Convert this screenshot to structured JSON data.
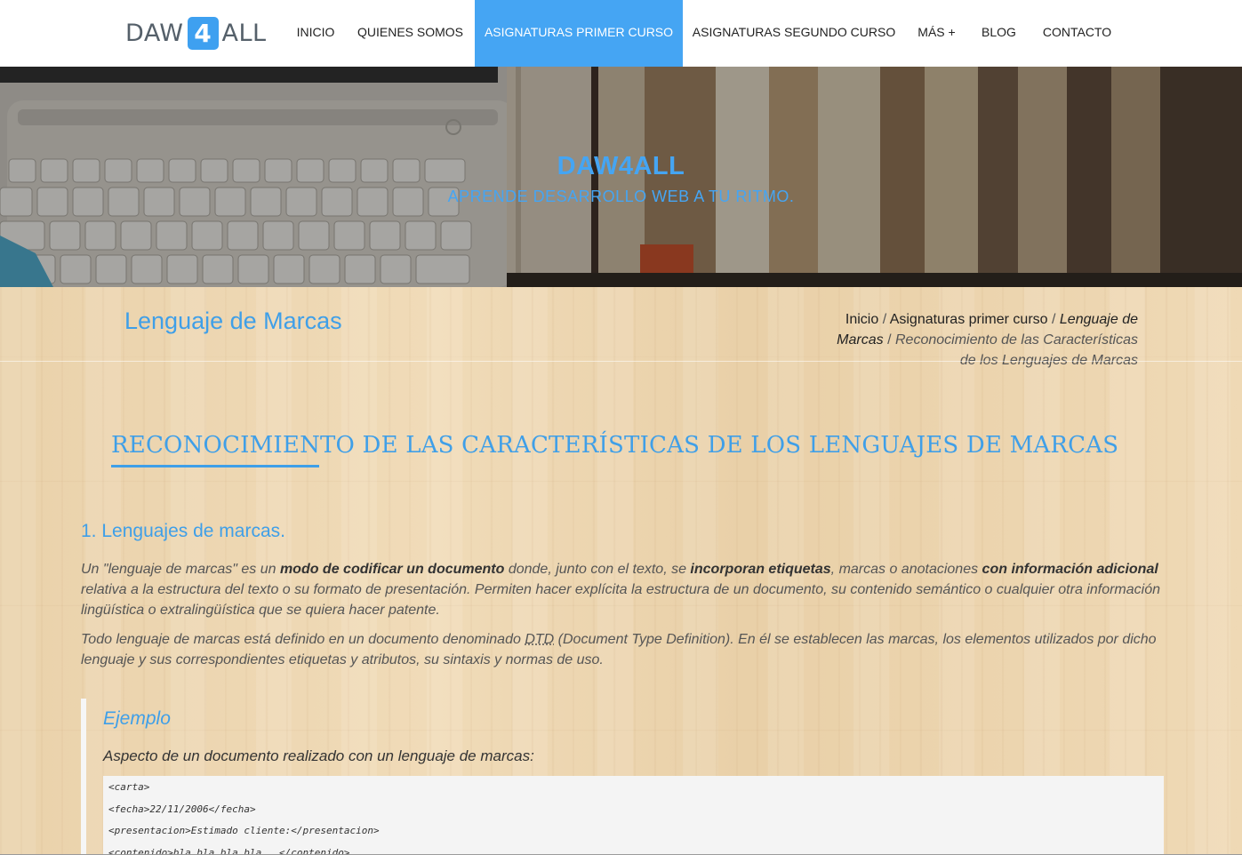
{
  "navbar": {
    "logo": {
      "left": "DAW",
      "number": "4",
      "right": "ALL"
    },
    "items": [
      {
        "label": "INICIO",
        "active": false
      },
      {
        "label": "QUIENES SOMOS",
        "active": false
      },
      {
        "label": "ASIGNATURAS PRIMER CURSO",
        "active": true
      },
      {
        "label": "ASIGNATURAS SEGUNDO CURSO",
        "active": false
      },
      {
        "label": "MÁS +",
        "active": false
      },
      {
        "label": "BLOG",
        "active": false
      },
      {
        "label": "CONTACTO",
        "active": false
      }
    ]
  },
  "hero": {
    "title": "DAW4ALL",
    "subtitle": "APRENDE DESARROLLO WEB A TU RITMO."
  },
  "section": {
    "title": "Lenguaje de Marcas",
    "breadcrumb": {
      "home": "Inicio",
      "category": "Asignaturas primer curso",
      "subject": "Lenguaje de Marcas",
      "current": "Reconocimiento de las Características de los Lenguajes de Marcas",
      "separator": "/"
    }
  },
  "article": {
    "title": "RECONOCIMIENTO DE LAS CARACTERÍSTICAS DE LOS LENGUAJES DE MARCAS",
    "heading": "1. Lenguajes de marcas.",
    "p1": {
      "a": "Un \"lenguaje de marcas\" es un ",
      "b": "modo de codificar un documento",
      "c": " donde, junto con el texto, se ",
      "d": "incorporan etiquetas",
      "e": ", marcas o anotaciones ",
      "f": "con información adicional",
      "g": " relativa a la estructura del texto o su formato de presentación. Permiten hacer explícita la estructura de un documento, su contenido semántico o cualquier otra información lingüística o extralingüística que se quiera hacer patente."
    },
    "p2": {
      "a": "Todo lenguaje de marcas está definido en un documento denominado ",
      "abbr": "DTD",
      "b": " (Document Type Definition). En él se establecen las marcas, los elementos utilizados por dicho lenguaje y sus correspondientes etiquetas y atributos, su sintaxis y normas de uso."
    },
    "example": {
      "title": "Ejemplo",
      "description": "Aspecto de un documento realizado con un lenguaje de marcas:",
      "code_lines": [
        "<carta>",
        "<fecha>22/11/2006</fecha>",
        "<presentacion>Estimado cliente:</presentacion>",
        "<contenido>bla bla bla bla ..</contenido>"
      ]
    }
  },
  "colors": {
    "accent": "#45a5f3",
    "heading_blue": "#3f9fe8",
    "wood_background": "#ecd5b0",
    "text": "#555555"
  }
}
